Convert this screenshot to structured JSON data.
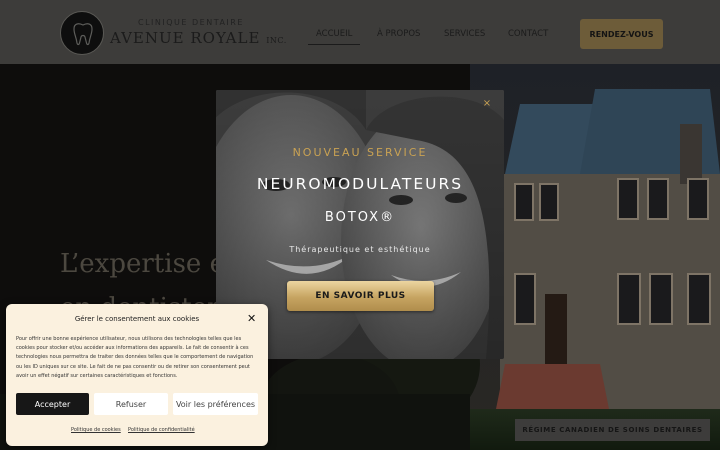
{
  "header": {
    "logo_subtitle": "CLINIQUE DENTAIRE",
    "logo_title": "AVENUE ROYALE",
    "logo_suffix": "INC.",
    "nav": [
      {
        "label": "ACCUEIL",
        "active": true
      },
      {
        "label": "À PROPOS",
        "active": false
      },
      {
        "label": "SERVICES",
        "active": false
      },
      {
        "label": "CONTACT",
        "active": false
      }
    ],
    "cta_label": "RENDEZ-VOUS"
  },
  "hero": {
    "title_line1": "L’expertise et",
    "title_line2": "en dentisterie",
    "govt_button": "RÉGIME CANADIEN DE SOINS DENTAIRES"
  },
  "promo": {
    "close_icon": "×",
    "kicker": "NOUVEAU SERVICE",
    "heading": "NEUROMODULATEURS",
    "subheading": "BOTOX®",
    "description": "Thérapeutique et esthétique",
    "button_label": "EN SAVOIR PLUS"
  },
  "cookie": {
    "title": "Gérer le consentement aux cookies",
    "close_icon": "✕",
    "body": "Pour offrir une bonne expérience utilisateur, nous utilisons des technologies telles que les cookies pour stocker et/ou accéder aux informations des appareils. Le fait de consentir à ces technologies nous permettra de traiter des données telles que le comportement de navigation ou les ID uniques sur ce site. Le fait de ne pas consentir ou de retirer son consentement peut avoir un effet négatif sur certaines caractéristiques et fonctions.",
    "accept_label": "Accepter",
    "refuse_label": "Refuser",
    "prefs_label": "Voir les préférences",
    "cookie_policy_link": "Politique de cookies",
    "privacy_policy_link": "Politique de confidentialité"
  },
  "colors": {
    "gold": "#c9a253",
    "header_bg": "#3d3c3a",
    "cookie_bg": "#fbf1df"
  }
}
